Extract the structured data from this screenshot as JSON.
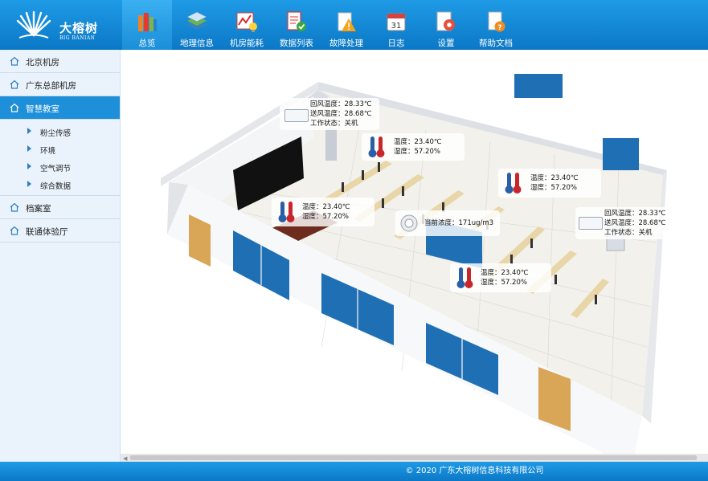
{
  "brand": {
    "name": "大榕树",
    "subtitle": "BIG BANIAN"
  },
  "nav": [
    {
      "label": "总览",
      "icon": "books-icon",
      "active": true
    },
    {
      "label": "地理信息",
      "icon": "map-layers-icon"
    },
    {
      "label": "机房能耗",
      "icon": "energy-chart-icon"
    },
    {
      "label": "数据列表",
      "icon": "data-list-icon"
    },
    {
      "label": "故障处理",
      "icon": "warning-icon"
    },
    {
      "label": "日志",
      "icon": "calendar-icon"
    },
    {
      "label": "设置",
      "icon": "gear-icon"
    },
    {
      "label": "帮助文档",
      "icon": "help-doc-icon"
    }
  ],
  "sidebar": {
    "items": [
      {
        "label": "北京机房",
        "icon": "home-icon"
      },
      {
        "label": "广东总部机房",
        "icon": "home-icon"
      },
      {
        "label": "智慧教室",
        "icon": "home-icon",
        "active": true,
        "children": [
          {
            "label": "粉尘传感"
          },
          {
            "label": "环境"
          },
          {
            "label": "空气调节"
          },
          {
            "label": "综合数据"
          }
        ]
      },
      {
        "label": "档案室",
        "icon": "home-icon"
      },
      {
        "label": "联通体验厅",
        "icon": "home-icon"
      }
    ]
  },
  "scene": {
    "ac_units": [
      {
        "return_label": "回风温度：",
        "return_value": "28.33℃",
        "supply_label": "送风温度：",
        "supply_value": "28.68℃",
        "status_label": "工作状态：",
        "status_value": "关机"
      },
      {
        "return_label": "回风温度：",
        "return_value": "28.33℃",
        "supply_label": "送风温度：",
        "supply_value": "28.68℃",
        "status_label": "工作状态：",
        "status_value": "关机"
      }
    ],
    "sensors": [
      {
        "temp_label": "温度：",
        "temp_value": "23.40℃",
        "hum_label": "湿度：",
        "hum_value": "57.20%"
      },
      {
        "temp_label": "温度：",
        "temp_value": "23.40℃",
        "hum_label": "湿度：",
        "hum_value": "57.20%"
      },
      {
        "temp_label": "温度：",
        "temp_value": "23.40℃",
        "hum_label": "湿度：",
        "hum_value": "57.20%"
      },
      {
        "temp_label": "温度：",
        "temp_value": "23.40℃",
        "hum_label": "湿度：",
        "hum_value": "57.20%"
      }
    ],
    "dust": {
      "label": "当前浓度：",
      "value": "171ug/m3"
    }
  },
  "footer": {
    "copyright": "© 2020  广东大榕树信息科技有限公司"
  },
  "colors": {
    "header": "#1489d6",
    "sidebar_active": "#1e8fd9",
    "sidebar_bg": "#eaf3fb"
  }
}
